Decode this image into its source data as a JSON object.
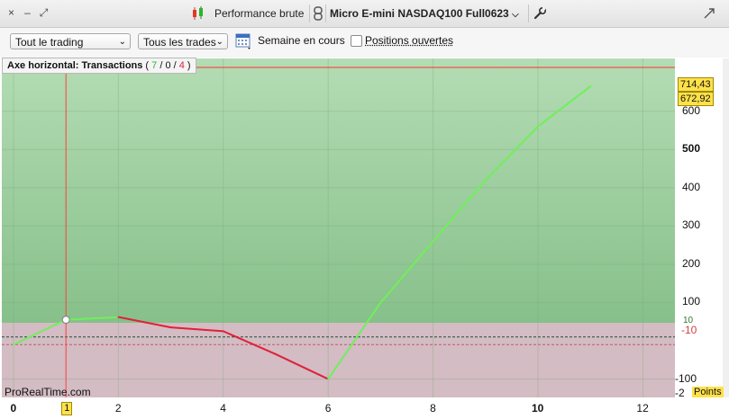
{
  "titlebar": {
    "close_icon": "×",
    "minimize_icon": "–",
    "expand_icon": "⤢",
    "chart_label": "Performance brute",
    "instrument": "Micro E-mini NASDAQ100 Full0623",
    "link_icon": "chain-link-icon",
    "wrench_icon": "wrench-icon"
  },
  "toolbar": {
    "trading_select": "Tout le trading",
    "trades_select": "Tous les trades",
    "period_label": "Semaine en cours",
    "open_positions_label": "Positions ouvertes",
    "open_positions_checked": false
  },
  "chart_header": {
    "prefix": "Axe horizontal: ",
    "mode": "Transactions",
    "open_paren": " ( ",
    "wins": "7",
    "slash1": " / ",
    "even": "0",
    "slash2": " / ",
    "losses": "4",
    "close_paren": " )",
    "win_color": "#36b336",
    "loss_color": "#e0203a"
  },
  "watermark": "ProRealTime.com",
  "price_tags": {
    "high": "714,43",
    "current": "672,92"
  },
  "threshold_labels": {
    "upper": "10",
    "lower": "-10"
  },
  "points_label": "Points",
  "chart_data": {
    "type": "line",
    "x": [
      0,
      1,
      2,
      3,
      4,
      5,
      6,
      7,
      8,
      9,
      10,
      11
    ],
    "y": [
      -10,
      55,
      62,
      35,
      25,
      -35,
      -100,
      100,
      260,
      420,
      560,
      665
    ],
    "segment_colors": [
      "#6ff05a",
      "#6ff05a",
      "#e0203a",
      "#e0203a",
      "#e0203a",
      "#e0203a",
      "#6ff05a",
      "#6ff05a",
      "#6ff05a",
      "#6ff05a",
      "#6ff05a"
    ],
    "x_ticks": [
      "0",
      "1",
      "2",
      "4",
      "6",
      "8",
      "10",
      "12"
    ],
    "x_bold": [
      "0",
      "10"
    ],
    "y_ticks": [
      "600",
      "500",
      "400",
      "300",
      "200",
      "100",
      "-100",
      "-2"
    ],
    "y_bold": [
      "500"
    ],
    "xlim": [
      0,
      12.4
    ],
    "ylim": [
      -148,
      738
    ],
    "crosshair_x": 1,
    "max_line_y": 714.43,
    "upper_threshold": 10,
    "lower_threshold": -10,
    "gain_color": "#a9d6a9",
    "loss_color": "#d3bcc3"
  }
}
